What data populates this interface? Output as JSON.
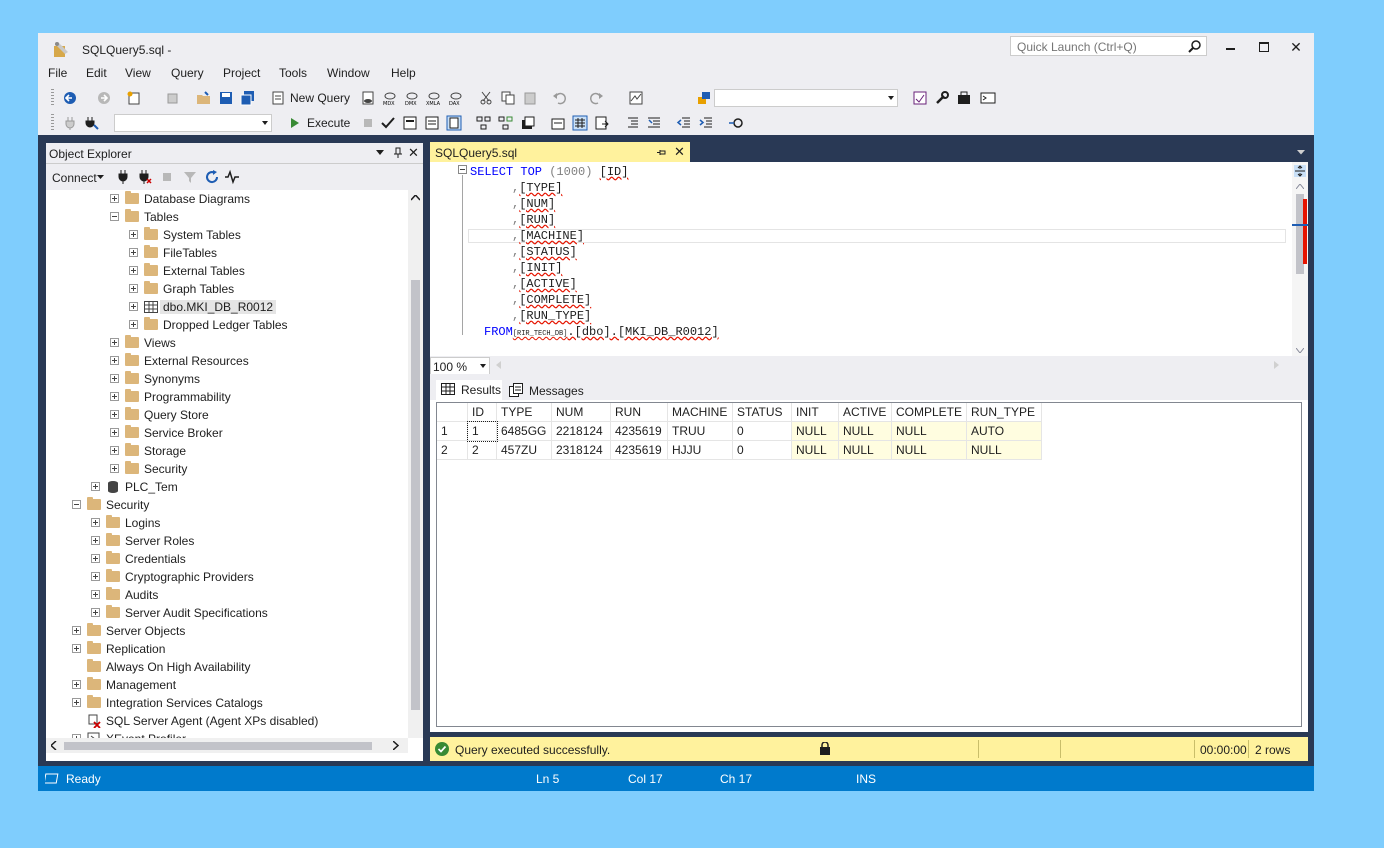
{
  "window": {
    "title": "SQLQuery5.sql -",
    "quick_launch_placeholder": "Quick Launch (Ctrl+Q)"
  },
  "menu": [
    "File",
    "Edit",
    "View",
    "Query",
    "Project",
    "Tools",
    "Window",
    "Help"
  ],
  "toolbar": {
    "new_query": "New Query",
    "execute": "Execute"
  },
  "object_explorer": {
    "title": "Object Explorer",
    "connect": "Connect",
    "tree": [
      {
        "label": "Database Diagrams",
        "level": 3,
        "state": "collapsed",
        "icon": "folder"
      },
      {
        "label": "Tables",
        "level": 3,
        "state": "expanded",
        "icon": "folder"
      },
      {
        "label": "System Tables",
        "level": 4,
        "state": "collapsed",
        "icon": "folder"
      },
      {
        "label": "FileTables",
        "level": 4,
        "state": "collapsed",
        "icon": "folder"
      },
      {
        "label": "External Tables",
        "level": 4,
        "state": "collapsed",
        "icon": "folder"
      },
      {
        "label": "Graph Tables",
        "level": 4,
        "state": "collapsed",
        "icon": "folder"
      },
      {
        "label": "dbo.MKI_DB_R0012",
        "level": 4,
        "state": "collapsed",
        "icon": "table",
        "selected": true
      },
      {
        "label": "Dropped Ledger Tables",
        "level": 4,
        "state": "collapsed",
        "icon": "folder"
      },
      {
        "label": "Views",
        "level": 3,
        "state": "collapsed",
        "icon": "folder"
      },
      {
        "label": "External Resources",
        "level": 3,
        "state": "collapsed",
        "icon": "folder"
      },
      {
        "label": "Synonyms",
        "level": 3,
        "state": "collapsed",
        "icon": "folder"
      },
      {
        "label": "Programmability",
        "level": 3,
        "state": "collapsed",
        "icon": "folder"
      },
      {
        "label": "Query Store",
        "level": 3,
        "state": "collapsed",
        "icon": "folder"
      },
      {
        "label": "Service Broker",
        "level": 3,
        "state": "collapsed",
        "icon": "folder"
      },
      {
        "label": "Storage",
        "level": 3,
        "state": "collapsed",
        "icon": "folder"
      },
      {
        "label": "Security",
        "level": 3,
        "state": "collapsed",
        "icon": "folder"
      },
      {
        "label": "PLC_Tem",
        "level": 2,
        "state": "collapsed",
        "icon": "database"
      },
      {
        "label": "Security",
        "level": 1,
        "state": "expanded",
        "icon": "folder"
      },
      {
        "label": "Logins",
        "level": 2,
        "state": "collapsed",
        "icon": "folder"
      },
      {
        "label": "Server Roles",
        "level": 2,
        "state": "collapsed",
        "icon": "folder"
      },
      {
        "label": "Credentials",
        "level": 2,
        "state": "collapsed",
        "icon": "folder"
      },
      {
        "label": "Cryptographic Providers",
        "level": 2,
        "state": "collapsed",
        "icon": "folder"
      },
      {
        "label": "Audits",
        "level": 2,
        "state": "collapsed",
        "icon": "folder"
      },
      {
        "label": "Server Audit Specifications",
        "level": 2,
        "state": "collapsed",
        "icon": "folder"
      },
      {
        "label": "Server Objects",
        "level": 1,
        "state": "collapsed",
        "icon": "folder"
      },
      {
        "label": "Replication",
        "level": 1,
        "state": "collapsed",
        "icon": "folder"
      },
      {
        "label": "Always On High Availability",
        "level": 1,
        "state": "none",
        "icon": "folder"
      },
      {
        "label": "Management",
        "level": 1,
        "state": "collapsed",
        "icon": "folder"
      },
      {
        "label": "Integration Services Catalogs",
        "level": 1,
        "state": "collapsed",
        "icon": "folder"
      },
      {
        "label": "SQL Server Agent (Agent XPs disabled)",
        "level": 1,
        "state": "none",
        "icon": "agent"
      },
      {
        "label": "XEvent Profiler",
        "level": 1,
        "state": "collapsed",
        "icon": "profiler"
      }
    ]
  },
  "editor": {
    "tab_title": "SQLQuery5.sql",
    "zoom": "100 %",
    "lines": [
      {
        "kw": "SELECT TOP",
        "rest": " (1000) ",
        "col": "[ID]"
      },
      {
        "comma": ",",
        "col": "[TYPE]"
      },
      {
        "comma": ",",
        "col": "[NUM]"
      },
      {
        "comma": ",",
        "col": "[RUN]"
      },
      {
        "comma": ",",
        "col": "[MACHINE]"
      },
      {
        "comma": ",",
        "col": "[STATUS]"
      },
      {
        "comma": ",",
        "col": "[INIT]"
      },
      {
        "comma": ",",
        "col": "[ACTIVE]"
      },
      {
        "comma": ",",
        "col": "[COMPLETE]"
      },
      {
        "comma": ",",
        "col": "[RUN_TYPE]"
      }
    ],
    "from_line": {
      "kw": "FROM",
      "db": "[RIR_TECH_DB]",
      "rest": ".[dbo].[MKI_DB_R0012]"
    }
  },
  "results": {
    "tabs": [
      "Results",
      "Messages"
    ],
    "columns": [
      "ID",
      "TYPE",
      "NUM",
      "RUN",
      "MACHINE",
      "STATUS",
      "INIT",
      "ACTIVE",
      "COMPLETE",
      "RUN_TYPE"
    ],
    "rows": [
      [
        "1",
        "1",
        "6485GG",
        "2218124",
        "4235619",
        "TRUU",
        "0",
        "NULL",
        "NULL",
        "NULL",
        "AUTO"
      ],
      [
        "2",
        "2",
        "457ZU",
        "2318124",
        "4235619",
        "HJJU",
        "0",
        "NULL",
        "NULL",
        "NULL",
        "NULL"
      ]
    ]
  },
  "query_status": {
    "message": "Query executed successfully.",
    "elapsed": "00:00:00",
    "rows": "2 rows"
  },
  "status_bar": {
    "state": "Ready",
    "ln": "Ln 5",
    "col": "Col 17",
    "ch": "Ch 17",
    "mode": "INS"
  },
  "colors": {
    "background": "#7fcdfd",
    "accent": "#007acc",
    "tab_active": "#fff29d",
    "chrome": "#eeeef2",
    "dark": "#293955"
  }
}
